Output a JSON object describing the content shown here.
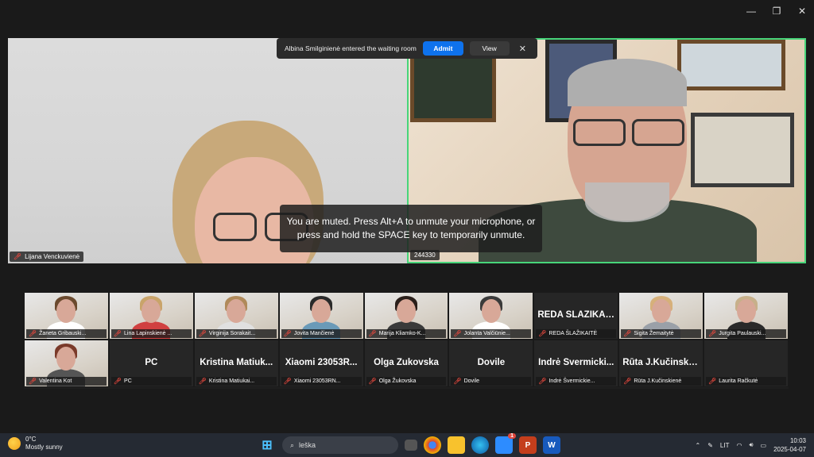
{
  "window": {
    "controls": {
      "minimize": "—",
      "restore": "❐",
      "close": "✕"
    }
  },
  "notification": {
    "message": "Albina Smilginienė entered the waiting room",
    "admit_label": "Admit",
    "view_label": "View",
    "close_label": "✕"
  },
  "main_videos": [
    {
      "name": "Lijana Venckuvienė",
      "muted": true
    },
    {
      "name": "244330",
      "muted": false,
      "active_speaker": true
    }
  ],
  "toast": {
    "line1": "You are muted. Press Alt+A to unmute your microphone, or",
    "line2": "press and hold the SPACE key to temporarily unmute."
  },
  "gallery": [
    {
      "name": "Žaneta Gribauski...",
      "video": true
    },
    {
      "name": "Lina Lapinskienė ...",
      "video": true
    },
    {
      "name": "Virginija Sorakait...",
      "video": true
    },
    {
      "name": "Jovita Mančienė",
      "video": true
    },
    {
      "name": "Marija Kliamko-K...",
      "video": true
    },
    {
      "name": "Jolanta Valčiūnie...",
      "video": true
    },
    {
      "name": "REDA ŠLAŽIKAITĖ",
      "display": "REDA ŠLAŽIKAITĖ",
      "video": false
    },
    {
      "name": "Sigita Žemaitytė",
      "video": true
    },
    {
      "name": "Jurgita Paulauski...",
      "video": true
    },
    {
      "name": "Valentina Kot",
      "video": true
    },
    {
      "name": "PC",
      "display": "PC",
      "video": false
    },
    {
      "name": "Kristina Matiukai...",
      "display": "Kristina Matiuk...",
      "video": false
    },
    {
      "name": "Xiaomi 23053RN...",
      "display": "Xiaomi 23053R...",
      "video": false
    },
    {
      "name": "Olga Žukovska",
      "display": "Olga Žukovska",
      "video": false
    },
    {
      "name": "Dovile",
      "display": "Dovile",
      "video": false
    },
    {
      "name": "Indrė Švermickie...",
      "display": "Indrė Švermicki...",
      "video": false
    },
    {
      "name": "Rūta J.Kučinskienė",
      "display": "Rūta J.Kučinskie...",
      "video": false
    },
    {
      "name": "Laurita Račkutė",
      "display": "",
      "video": false
    }
  ],
  "taskbar": {
    "weather_temp": "0°C",
    "weather_desc": "Mostly sunny",
    "search_text": "leška",
    "language": "LIT",
    "time": "10:03",
    "date": "2025-04-07",
    "zoom_badge": "1"
  },
  "colors": {
    "accent_blue": "#0e72ed",
    "active_speaker_border": "#47d57a",
    "muted_red": "#e0473d"
  }
}
